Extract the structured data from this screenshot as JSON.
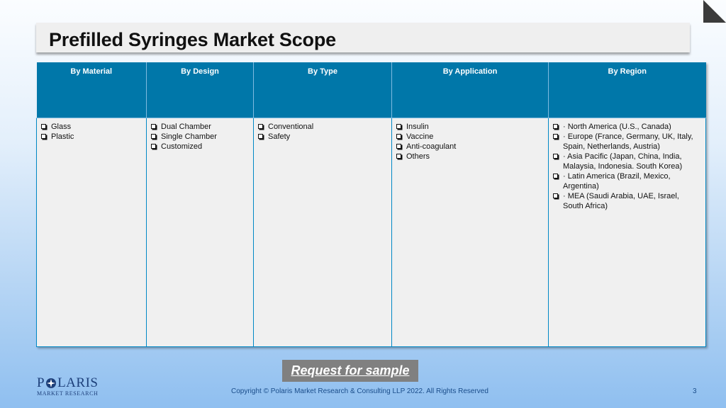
{
  "title": "Prefilled Syringes Market Scope",
  "table": {
    "headers": [
      "By Material",
      "By Design",
      "By Type",
      "By Application",
      "By Region"
    ],
    "columns": [
      [
        "Glass",
        "Plastic"
      ],
      [
        "Dual Chamber",
        "Single Chamber",
        "Customized"
      ],
      [
        "Conventional",
        "Safety"
      ],
      [
        "Insulin",
        "Vaccine",
        "Anti-coagulant",
        "Others"
      ],
      [
        "· North America (U.S., Canada)",
        "· Europe (France, Germany, UK, Italy, Spain, Netherlands, Austria)",
        "· Asia Pacific (Japan, China, India, Malaysia, Indonesia. South Korea)",
        "· Latin America (Brazil, Mexico, Argentina)",
        "· MEA (Saudi Arabia, UAE, Israel, South Africa)"
      ]
    ]
  },
  "request_button": "Request for sample",
  "logo": {
    "name": "POLARIS",
    "tagline": "MARKET RESEARCH"
  },
  "copyright": "Copyright © Polaris Market Research & Consulting LLP 2022. All Rights Reserved",
  "page_number": "3",
  "colors": {
    "header": "#0077a9",
    "cell": "#f0f0f0",
    "border": "#0088c6",
    "button": "#808080"
  },
  "icons": [
    "corner-fold-icon",
    "checkbox-bullet-icon",
    "polaris-star-icon"
  ]
}
